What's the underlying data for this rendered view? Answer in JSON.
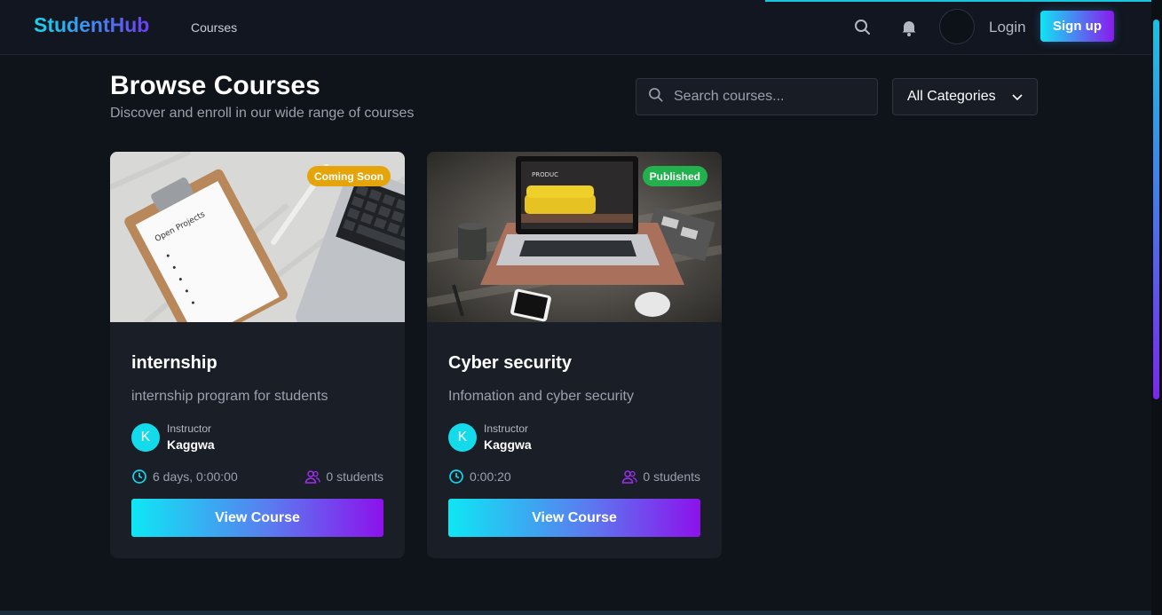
{
  "header": {
    "logo": "StudentHub",
    "nav_courses": "Courses",
    "login": "Login",
    "signup": "Sign up"
  },
  "page": {
    "title": "Browse Courses",
    "subtitle": "Discover and enroll in our wide range of courses"
  },
  "search": {
    "placeholder": "Search courses..."
  },
  "category_select": {
    "value": "All Categories"
  },
  "icons": {
    "search": "search-icon",
    "bell": "bell-icon",
    "clock": "clock-icon",
    "students": "users-icon",
    "chevron": "chevron-down-icon"
  },
  "colors": {
    "accent_cyan": "#12e0f0",
    "accent_purple": "#8c12ec",
    "badge_coming_soon": "#e5a50a",
    "badge_published": "#22b14c"
  },
  "courses": [
    {
      "title": "internship",
      "description": "internship program for students",
      "status": "Coming Soon",
      "instructor_label": "Instructor",
      "instructor_name": "Kaggwa",
      "instructor_initial": "K",
      "duration": "6 days, 0:00:00",
      "students": "0 students",
      "button": "View Course"
    },
    {
      "title": "Cyber security",
      "description": "Infomation and cyber security",
      "status": "Published",
      "instructor_label": "Instructor",
      "instructor_name": "Kaggwa",
      "instructor_initial": "K",
      "duration": "0:00:20",
      "students": "0 students",
      "button": "View Course"
    }
  ]
}
